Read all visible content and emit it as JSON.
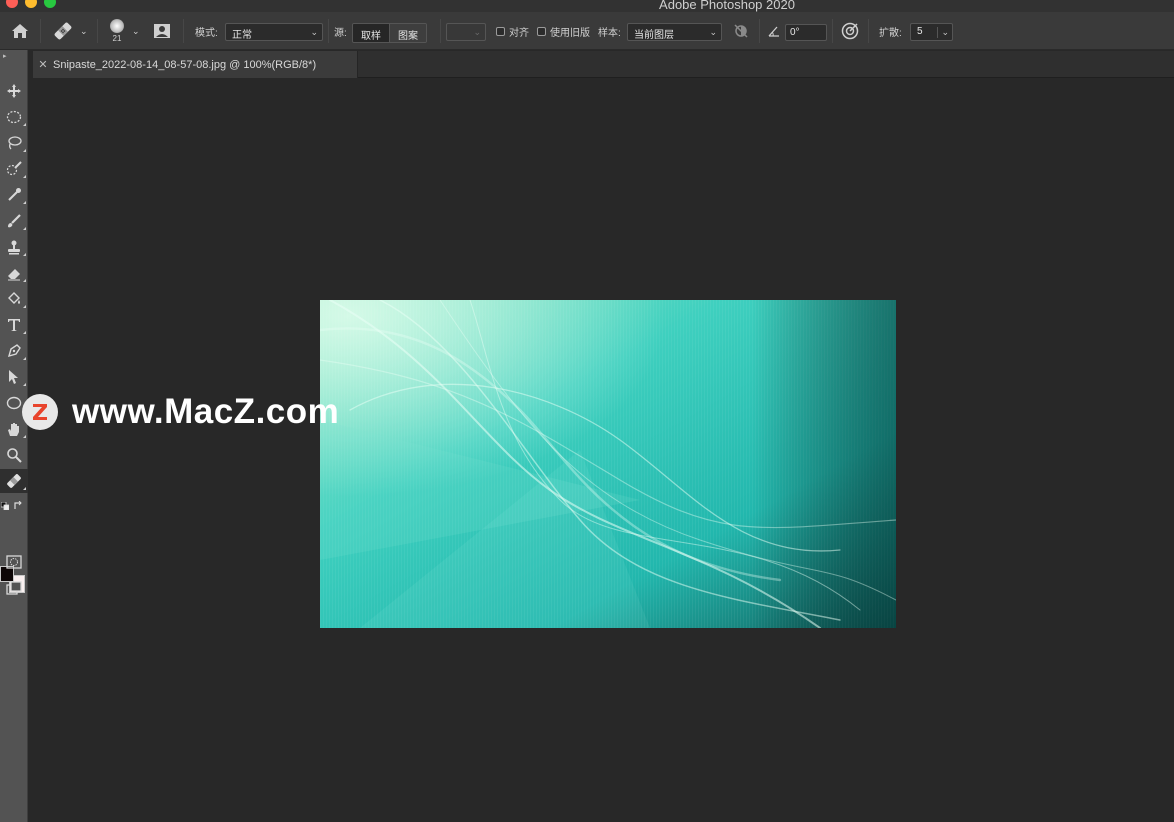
{
  "app": {
    "title": "Adobe Photoshop 2020"
  },
  "options_bar": {
    "brush_size": "21",
    "mode_label": "模式:",
    "mode_value": "正常",
    "source_label": "源:",
    "source_options": [
      "取样",
      "图案"
    ],
    "align_label": "对齐",
    "legacy_label": "使用旧版",
    "sample_label": "样本:",
    "sample_value": "当前图层",
    "angle_value": "0°",
    "diffusion_label": "扩散:",
    "diffusion_value": "5"
  },
  "document_tab": {
    "title": "Snipaste_2022-08-14_08-57-08.jpg @ 100%(RGB/8*)"
  },
  "watermark": {
    "text": "www.MacZ.com",
    "logo_letter": "Z"
  },
  "colors": {
    "foreground": "#0d0606",
    "background": "#faf0f0",
    "accent": "#2fd3c4"
  }
}
